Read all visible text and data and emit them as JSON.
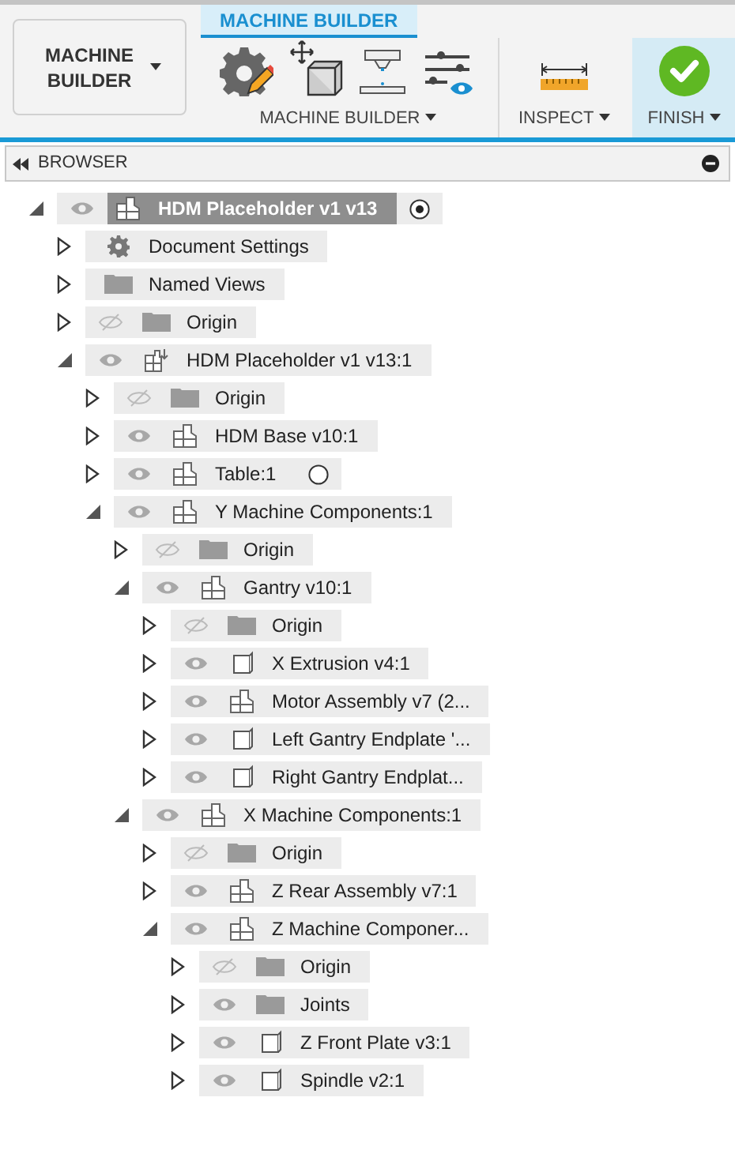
{
  "workspace_button": {
    "label": "MACHINE BUILDER"
  },
  "tab": {
    "label": "MACHINE BUILDER",
    "selected": true
  },
  "groups": [
    {
      "label": "MACHINE BUILDER",
      "kind": "tools"
    },
    {
      "label": "INSPECT",
      "kind": "inspect"
    },
    {
      "label": "FINISH",
      "kind": "finish"
    }
  ],
  "browser": {
    "title": "BROWSER",
    "tree": [
      {
        "label": "HDM Placeholder v1 v13",
        "kind": "assembly",
        "visible": true,
        "expanded": true,
        "selected": true,
        "active": true,
        "children": [
          {
            "label": "Document Settings",
            "kind": "settings",
            "expanded": false,
            "selected": false
          },
          {
            "label": "Named Views",
            "kind": "folder",
            "expanded": false,
            "selected": false
          },
          {
            "label": "Origin",
            "kind": "folder",
            "visible": false,
            "expanded": false,
            "selected": false
          },
          {
            "label": "HDM Placeholder v1 v13:1",
            "kind": "linked",
            "visible": true,
            "expanded": true,
            "selected": false,
            "children": [
              {
                "label": "Origin",
                "kind": "folder",
                "visible": false,
                "expanded": false,
                "selected": false
              },
              {
                "label": "HDM Base v10:1",
                "kind": "assembly",
                "visible": true,
                "expanded": false,
                "selected": false
              },
              {
                "label": "Table:1",
                "kind": "assembly",
                "visible": true,
                "expanded": false,
                "selected": false,
                "active": false
              },
              {
                "label": "Y Machine Components:1",
                "kind": "assembly",
                "visible": true,
                "expanded": true,
                "selected": false,
                "children": [
                  {
                    "label": "Origin",
                    "kind": "folder",
                    "visible": false,
                    "expanded": false,
                    "selected": false
                  },
                  {
                    "label": "Gantry v10:1",
                    "kind": "assembly",
                    "visible": true,
                    "expanded": true,
                    "selected": false,
                    "children": [
                      {
                        "label": "Origin",
                        "kind": "folder",
                        "visible": false,
                        "expanded": false,
                        "selected": false
                      },
                      {
                        "label": "X Extrusion v4:1",
                        "kind": "body",
                        "visible": true,
                        "expanded": false,
                        "selected": false
                      },
                      {
                        "label": "Motor Assembly v7 (2...",
                        "kind": "assembly",
                        "visible": true,
                        "expanded": false,
                        "selected": false
                      },
                      {
                        "label": "Left Gantry Endplate '...",
                        "kind": "body",
                        "visible": true,
                        "expanded": false,
                        "selected": false
                      },
                      {
                        "label": "Right Gantry Endplat...",
                        "kind": "body",
                        "visible": true,
                        "expanded": false,
                        "selected": false
                      }
                    ]
                  },
                  {
                    "label": "X Machine Components:1",
                    "kind": "assembly",
                    "visible": true,
                    "expanded": true,
                    "selected": false,
                    "children": [
                      {
                        "label": "Origin",
                        "kind": "folder",
                        "visible": false,
                        "expanded": false,
                        "selected": false
                      },
                      {
                        "label": "Z Rear Assembly v7:1",
                        "kind": "assembly",
                        "visible": true,
                        "expanded": false,
                        "selected": false
                      },
                      {
                        "label": "Z Machine Componer...",
                        "kind": "assembly",
                        "visible": true,
                        "expanded": true,
                        "selected": false,
                        "children": [
                          {
                            "label": "Origin",
                            "kind": "folder",
                            "visible": false,
                            "expanded": false,
                            "selected": false
                          },
                          {
                            "label": "Joints",
                            "kind": "folder",
                            "visible": true,
                            "expanded": false,
                            "selected": false
                          },
                          {
                            "label": "Z Front Plate v3:1",
                            "kind": "body",
                            "visible": true,
                            "expanded": false,
                            "selected": false
                          },
                          {
                            "label": "Spindle v2:1",
                            "kind": "body",
                            "visible": true,
                            "expanded": false,
                            "selected": false
                          }
                        ]
                      }
                    ]
                  }
                ]
              }
            ]
          }
        ]
      }
    ]
  }
}
